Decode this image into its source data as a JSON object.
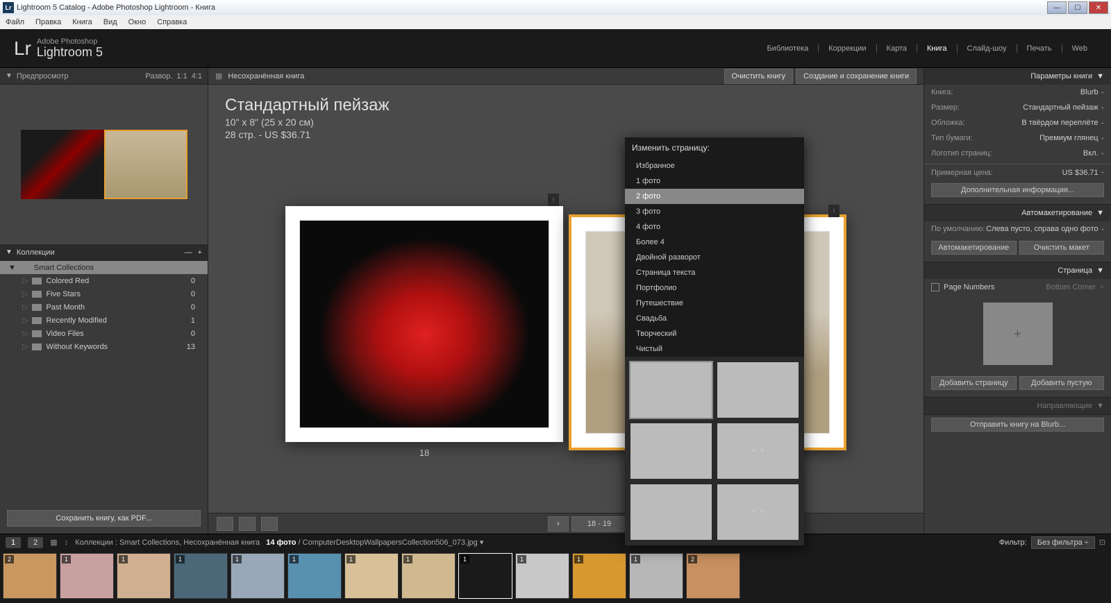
{
  "window": {
    "title": "Lightroom 5 Catalog - Adobe Photoshop Lightroom - Книга"
  },
  "menubar": [
    "Файл",
    "Правка",
    "Книга",
    "Вид",
    "Окно",
    "Справка"
  ],
  "logo": {
    "brand": "Adobe Photoshop",
    "product": "Lightroom 5",
    "mark": "Lr"
  },
  "modules": [
    "Библиотека",
    "Коррекции",
    "Карта",
    "Книга",
    "Слайд-шоу",
    "Печать",
    "Web"
  ],
  "active_module": "Книга",
  "left": {
    "preview": {
      "title": "Предпросмотр",
      "ratios": [
        "Развор.",
        "1:1",
        "4:1"
      ]
    },
    "collections": {
      "title": "Коллекции",
      "parent": "Smart Collections",
      "items": [
        {
          "name": "Colored Red",
          "count": 0
        },
        {
          "name": "Five Stars",
          "count": 0
        },
        {
          "name": "Past Month",
          "count": 0
        },
        {
          "name": "Recently Modified",
          "count": 1
        },
        {
          "name": "Video Files",
          "count": 0
        },
        {
          "name": "Without Keywords",
          "count": 13
        }
      ]
    },
    "save_btn": "Сохранить книгу, как PDF..."
  },
  "center": {
    "unsaved": "Несохранённая книга",
    "clear": "Очистить книгу",
    "create": "Создание и сохранение книги",
    "title": "Стандартный пейзаж",
    "size": "10\" x 8\" (25 x 20 см)",
    "price": "28 стр. - US $36.71",
    "left_num": "18",
    "page_display": "18 - 19"
  },
  "popup": {
    "title": "Изменить страницу:",
    "selected": "2 фото",
    "items": [
      "Избранное",
      "1 фото",
      "2 фото",
      "3 фото",
      "4 фото",
      "Более 4",
      "Двойной разворот",
      "Страница текста",
      "Портфолио",
      "Путешествие",
      "Свадьба",
      "Творческий",
      "Чистый"
    ]
  },
  "right": {
    "settings": {
      "title": "Параметры книги",
      "rows": [
        {
          "label": "Книга:",
          "value": "Blurb"
        },
        {
          "label": "Размер:",
          "value": "Стандартный пейзаж"
        },
        {
          "label": "Обложка:",
          "value": "В твёрдом переплёте"
        },
        {
          "label": "Тип бумаги:",
          "value": "Премиум глянец"
        },
        {
          "label": "Логотип страниц:",
          "value": "Вкл."
        }
      ],
      "price_label": "Примерная цена:",
      "price_value": "US $36.71",
      "more": "Дополнительная информация..."
    },
    "autolayout": {
      "title": "Автомакетирование",
      "preset_label": "По умолчанию:",
      "preset_value": "Слева пусто, справа одно фото",
      "b1": "Автомакетирование",
      "b2": "Очистить макет"
    },
    "page": {
      "title": "Страница",
      "cb": "Page Numbers",
      "cb_val": "Bottom Corner",
      "b1": "Добавить страницу",
      "b2": "Добавить пустую"
    },
    "guides": {
      "title": "Направляющие"
    },
    "send": "Отправить книгу на Blurb..."
  },
  "filmstrip": {
    "tab1": "1",
    "tab2": "2",
    "path_prefix": "Коллекции : Smart Collections, Несохранённая книга",
    "count": "14 фото",
    "filename": "/ ComputerDesktopWallpapersCollection506_073.jpg",
    "filter_label": "Фильтр:",
    "filter_value": "Без фильтра",
    "badges": [
      "2",
      "1",
      "1",
      "1",
      "1",
      "1",
      "1",
      "1",
      "1",
      "1",
      "1",
      "1",
      "2"
    ]
  }
}
